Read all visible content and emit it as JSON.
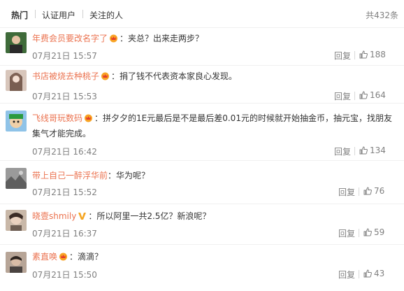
{
  "header": {
    "tabs": [
      {
        "label": "热门"
      },
      {
        "label": "认证用户"
      },
      {
        "label": "关注的人"
      }
    ],
    "total": "共432条"
  },
  "comments": [
    {
      "user": "年费会员要改名字了",
      "text": "：夹总？出来走两步？",
      "time": "07月21日 15:57",
      "reply": "回复",
      "likes": "188"
    },
    {
      "user": "书店被烧去种桃子",
      "text": "：捐了钱不代表资本家良心发现。",
      "time": "07月21日 15:53",
      "reply": "回复",
      "likes": "164"
    },
    {
      "user": "飞线哥玩数码",
      "text": "：拼夕夕的1E元最后是不是最后差0.01元的时候就开始抽金币，抽元宝，找朋友集气才能完成。",
      "time": "07月21日 16:42",
      "reply": "回复",
      "likes": "134"
    },
    {
      "user": "带上自己一醉浮华前",
      "text": "：华为呢？",
      "time": "07月21日 15:52",
      "reply": "回复",
      "likes": "76"
    },
    {
      "user": "晓壹shmily",
      "text": "：所以阿里一共2.5亿？新浪呢？",
      "time": "07月21日 16:37",
      "reply": "回复",
      "likes": "59"
    },
    {
      "user": "素直唤",
      "text": "：滴滴？",
      "time": "07月21日 15:50",
      "reply": "回复",
      "likes": "43"
    }
  ],
  "colors": {
    "username": "#eb7350",
    "meta": "#808080",
    "text": "#333333"
  }
}
